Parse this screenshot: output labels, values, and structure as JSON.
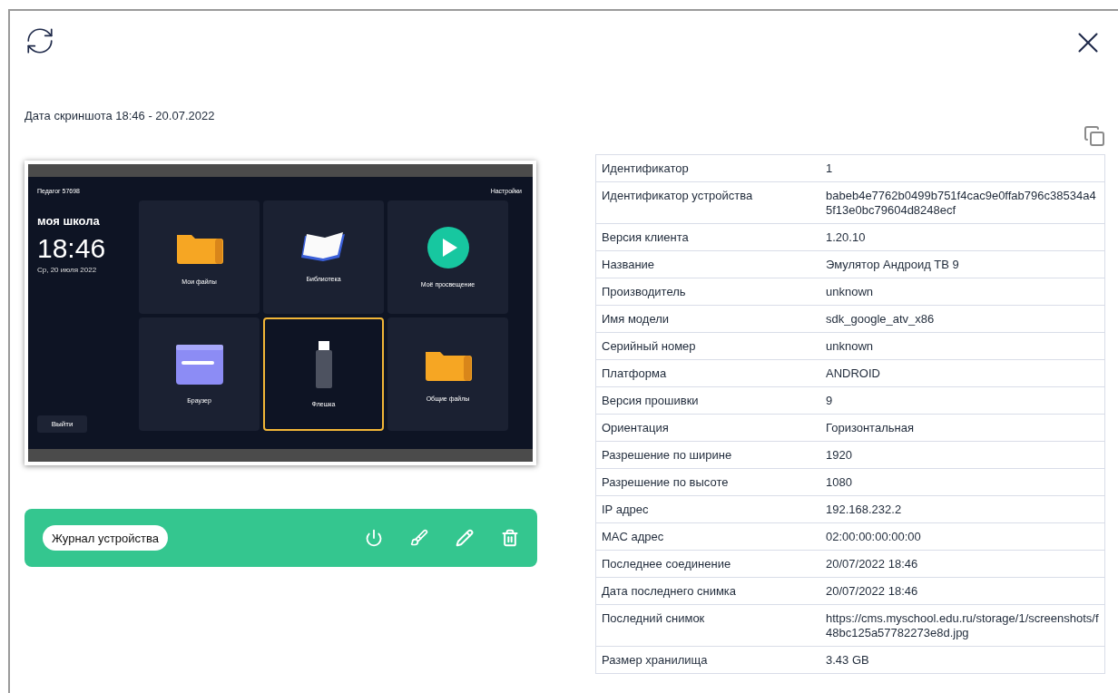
{
  "screenshot_date": "Дата скриншота 18:46 - 20.07.2022",
  "screenshot": {
    "user": "Педагог 57698",
    "settings": "Настройки",
    "school": "моя школа",
    "time": "18:46",
    "date": "Ср, 20 июля 2022",
    "logout": "Выйти",
    "tiles": [
      {
        "label": "Мои файлы",
        "kind": "folder",
        "selected": false
      },
      {
        "label": "Библиотека",
        "kind": "book",
        "selected": false
      },
      {
        "label": "Моё просвещение",
        "kind": "play",
        "selected": false
      },
      {
        "label": "Браузер",
        "kind": "browser",
        "selected": false
      },
      {
        "label": "Флешка",
        "kind": "usb",
        "selected": true
      },
      {
        "label": "Общие файлы",
        "kind": "folder",
        "selected": false
      }
    ]
  },
  "actions": {
    "log_button": "Журнал устройства"
  },
  "details": [
    {
      "label": "Идентификатор",
      "value": "1"
    },
    {
      "label": "Идентификатор устройства",
      "value": "babeb4e7762b0499b751f4cac9e0ffab796c38534a45f13e0bc79604d8248ecf"
    },
    {
      "label": "Версия клиента",
      "value": "1.20.10"
    },
    {
      "label": "Название",
      "value": "Эмулятор Андроид ТВ 9"
    },
    {
      "label": "Производитель",
      "value": "unknown"
    },
    {
      "label": "Имя модели",
      "value": "sdk_google_atv_x86"
    },
    {
      "label": "Серийный номер",
      "value": "unknown"
    },
    {
      "label": "Платформа",
      "value": "ANDROID"
    },
    {
      "label": "Версия прошивки",
      "value": "9"
    },
    {
      "label": "Ориентация",
      "value": "Горизонтальная"
    },
    {
      "label": "Разрешение по ширине",
      "value": "1920"
    },
    {
      "label": "Разрешение по высоте",
      "value": "1080"
    },
    {
      "label": "IP адрес",
      "value": "192.168.232.2"
    },
    {
      "label": "MAC адрес",
      "value": "02:00:00:00:00:00"
    },
    {
      "label": "Последнее соединение",
      "value": "20/07/2022 18:46"
    },
    {
      "label": "Дата последнего снимка",
      "value": "20/07/2022 18:46"
    },
    {
      "label": "Последний снимок",
      "value": "https://cms.myschool.edu.ru/storage/1/screenshots/f48bc125a57782273e8d.jpg"
    },
    {
      "label": "Размер хранилища",
      "value": "3.43 GB"
    }
  ]
}
